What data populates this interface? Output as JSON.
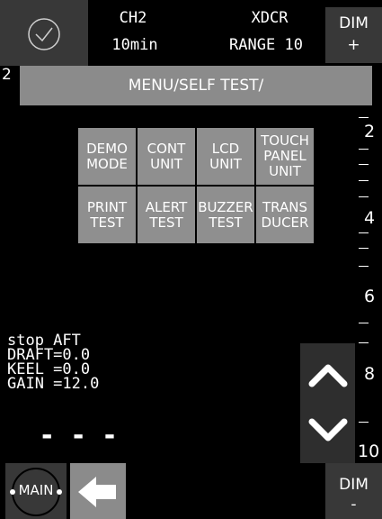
{
  "header": {
    "channel": "CH2",
    "interval": "10min",
    "transducer": "XDCR",
    "range": "RANGE 10",
    "dim_plus_label": "DIM",
    "dim_plus_sign": "+",
    "check_icon": "check-circle-icon"
  },
  "range_marker_top": "2",
  "menu": {
    "title": "MENU/SELF TEST/"
  },
  "test_buttons": [
    {
      "label": "DEMO\nMODE"
    },
    {
      "label": "CONT\nUNIT"
    },
    {
      "label": "LCD\nUNIT"
    },
    {
      "label": "TOUCH\nPANEL\nUNIT"
    },
    {
      "label": "PRINT\nTEST"
    },
    {
      "label": "ALERT\nTEST"
    },
    {
      "label": "BUZZER\nTEST"
    },
    {
      "label": "TRANS\nDUCER"
    }
  ],
  "depth_scale": {
    "labels": [
      "2",
      "4",
      "6",
      "8",
      "10"
    ]
  },
  "status": {
    "line1": "stop AFT",
    "line2": "DRAFT=0.0",
    "line3": "KEEL =0.0",
    "line4": "GAIN =12.0"
  },
  "depth_readout": "- - -",
  "footer": {
    "main_label": "MAIN",
    "dim_minus_label": "DIM",
    "dim_minus_sign": "-",
    "back_icon": "arrow-left-icon"
  },
  "icons": {
    "scroll_up": "chevron-up-icon",
    "scroll_down": "chevron-down-icon"
  },
  "colors": {
    "background": "#000000",
    "button_gray": "#8f8f8f",
    "dark_button": "#383838"
  }
}
